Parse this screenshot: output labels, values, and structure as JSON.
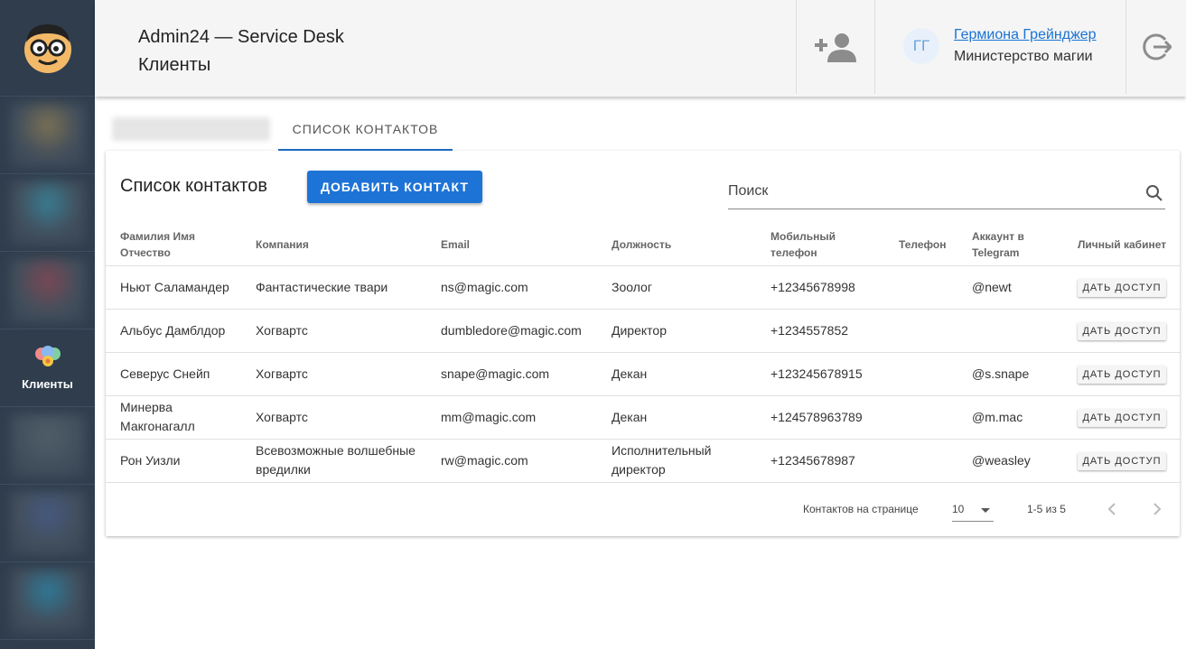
{
  "header": {
    "app_title": "Admin24 — Service Desk",
    "page_title": "Клиенты",
    "user_initials": "ГГ",
    "user_name": "Гермиона Грейнджер",
    "user_org": "Министерство магии"
  },
  "sidebar": {
    "active_item_label": "Клиенты",
    "blurred_colors": [
      "#8a7a55",
      "#3b8aa0",
      "#8a4a55",
      "#56656f",
      "#4a5f8a",
      "#2f85a5"
    ]
  },
  "tabs": {
    "active_label": "СПИСОК КОНТАКТОВ"
  },
  "contacts": {
    "title": "Список контактов",
    "add_button": "ДОБАВИТЬ КОНТАКТ",
    "search_placeholder": "Поиск",
    "columns": {
      "name": "Фамилия Имя Отчество",
      "company": "Компания",
      "email": "Email",
      "position": "Должность",
      "mobile": "Мобильный телефон",
      "phone": "Телефон",
      "telegram": "Аккаунт в Telegram",
      "cabinet": "Личный кабинет"
    },
    "rows": [
      {
        "name": "Ньют Саламандер",
        "company": "Фантастические твари",
        "email": "ns@magic.com",
        "position": "Зоолог",
        "mobile": "+12345678998",
        "phone": "",
        "telegram": "@newt",
        "action": "ДАТЬ ДОСТУП"
      },
      {
        "name": "Альбус Дамблдор",
        "company": "Хогвартс",
        "email": "dumbledore@magic.com",
        "position": "Директор",
        "mobile": "+1234557852",
        "phone": "",
        "telegram": "",
        "action": "ДАТЬ ДОСТУП"
      },
      {
        "name": "Северус Снейп",
        "company": "Хогвартс",
        "email": "snape@magic.com",
        "position": "Декан",
        "mobile": "+123245678915",
        "phone": "",
        "telegram": "@s.snape",
        "action": "ДАТЬ ДОСТУП"
      },
      {
        "name": "Минерва Макгонагалл",
        "company": "Хогвартс",
        "email": "mm@magic.com",
        "position": "Декан",
        "mobile": "+124578963789",
        "phone": "",
        "telegram": "@m.mac",
        "action": "ДАТЬ ДОСТУП"
      },
      {
        "name": "Рон Уизли",
        "company": "Всевозможные волшебные вредилки",
        "email": "rw@magic.com",
        "position": "Исполнительный директор",
        "mobile": "+12345678987",
        "phone": "",
        "telegram": "@weasley",
        "action": "ДАТЬ ДОСТУП"
      }
    ],
    "footer": {
      "per_page_label": "Контактов на странице",
      "per_page_value": "10",
      "range": "1-5 из 5"
    }
  },
  "colors": {
    "sidebar_bg": "#2f3d4d",
    "accent": "#1e74d6",
    "link": "#1a73d4"
  }
}
